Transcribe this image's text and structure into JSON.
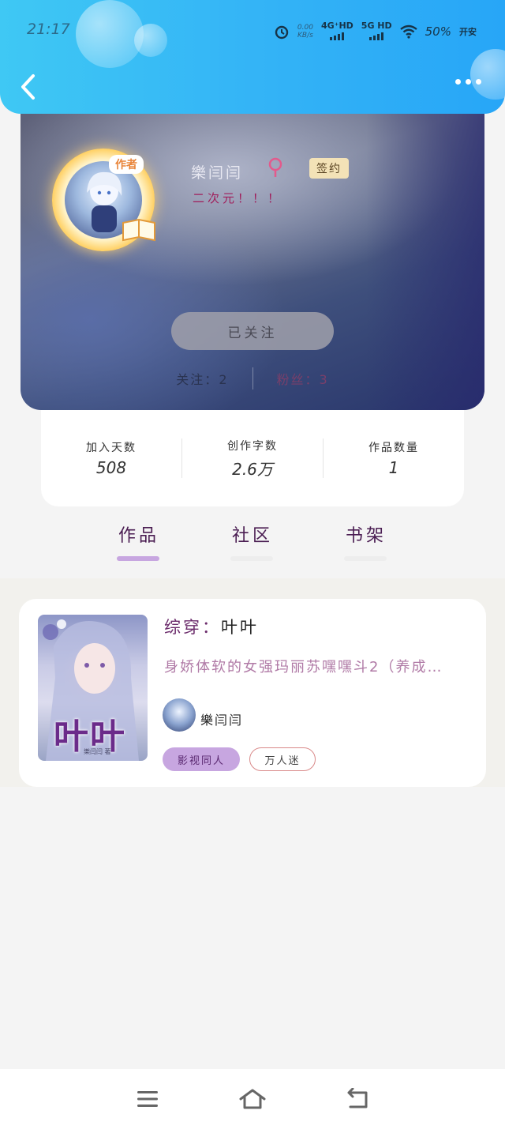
{
  "status_bar": {
    "time": "21:17",
    "net_speed": "0.00",
    "net_unit": "KB/s",
    "carrier1": "4G⁺HD",
    "carrier2": "5G HD",
    "battery": "50%",
    "extra": "开安"
  },
  "profile": {
    "avatar_badge": "作者",
    "name": "樂闫闫",
    "signed_badge": "签约",
    "bio": "二次元！！！",
    "follow_button": "已关注",
    "following_label": "关注：",
    "following_count": "2",
    "fans_label": "粉丝：",
    "fans_count": "3"
  },
  "stats": [
    {
      "label": "加入天数",
      "value": "508"
    },
    {
      "label": "创作字数",
      "value": "2.6万"
    },
    {
      "label": "作品数量",
      "value": "1"
    }
  ],
  "tabs": [
    {
      "label": "作品",
      "active": true
    },
    {
      "label": "社区",
      "active": false
    },
    {
      "label": "书架",
      "active": false
    }
  ],
  "book": {
    "category": "综穿：",
    "title": "叶叶",
    "description": "身娇体软的女强玛丽苏嘿嘿斗2（养成…",
    "cover_title": "叶叶",
    "cover_author": "樂闫闫 著",
    "author": "樂闫闫",
    "tags": [
      "影视同人",
      "万人迷"
    ]
  },
  "colors": {
    "header": "#34b4f6",
    "tab_active": "#c7a6e0",
    "accent_purple": "#4a1d52"
  },
  "icons": {
    "back": "chevron-left-icon",
    "more": "more-dots-icon",
    "location": "location-pin-icon",
    "alarm": "alarm-icon",
    "wifi": "wifi-icon",
    "menu": "menu-icon",
    "home": "home-icon",
    "back_nav": "return-icon"
  }
}
